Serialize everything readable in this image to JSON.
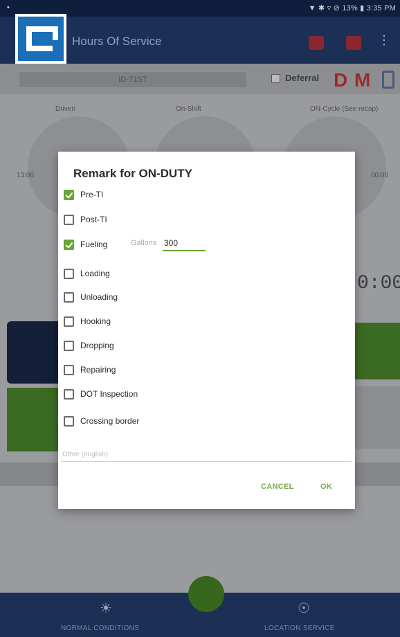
{
  "status_bar": {
    "left": "▪",
    "right": "▼ ✱ ▿ ⊘ 13% ▮ 3:35 PM"
  },
  "app_bar": {
    "title": "Hours Of Service",
    "more": "⋮"
  },
  "sub_bar": {
    "vehicle": "ID-T1ST",
    "deferral_label": "Deferral",
    "d_label": "D",
    "m_label": "M"
  },
  "gauges": {
    "labels": [
      "Driven",
      "On-Shift",
      "ON-Cycle (See recap)"
    ],
    "left_time": "13:00",
    "right_time": "00:00",
    "clock": "0:00"
  },
  "bottom_nav": {
    "left_label": "NORMAL CONDITIONS",
    "right_label": "LOCATION SERVICE",
    "left_icon": "☀",
    "right_icon": "☉"
  },
  "dialog": {
    "title": "Remark for ON-DUTY",
    "options": [
      {
        "label": "Pre-TI",
        "checked": true
      },
      {
        "label": "Post-TI",
        "checked": false
      },
      {
        "label": "Fueling",
        "checked": true
      },
      {
        "label": "Loading",
        "checked": false
      },
      {
        "label": "Unloading",
        "checked": false
      },
      {
        "label": "Hooking",
        "checked": false
      },
      {
        "label": "Dropping",
        "checked": false
      },
      {
        "label": "Repairing",
        "checked": false
      },
      {
        "label": "DOT Inspection",
        "checked": false
      },
      {
        "label": "Crossing border",
        "checked": false
      }
    ],
    "gallons_label": "Gallons",
    "gallons_value": "300",
    "other_placeholder": "Other (english)",
    "other_value": "",
    "cancel_label": "CANCEL",
    "ok_label": "OK"
  },
  "colors": {
    "accent_green": "#6aa336",
    "app_navy": "#1c2f55",
    "alert_red": "#c0392b"
  }
}
